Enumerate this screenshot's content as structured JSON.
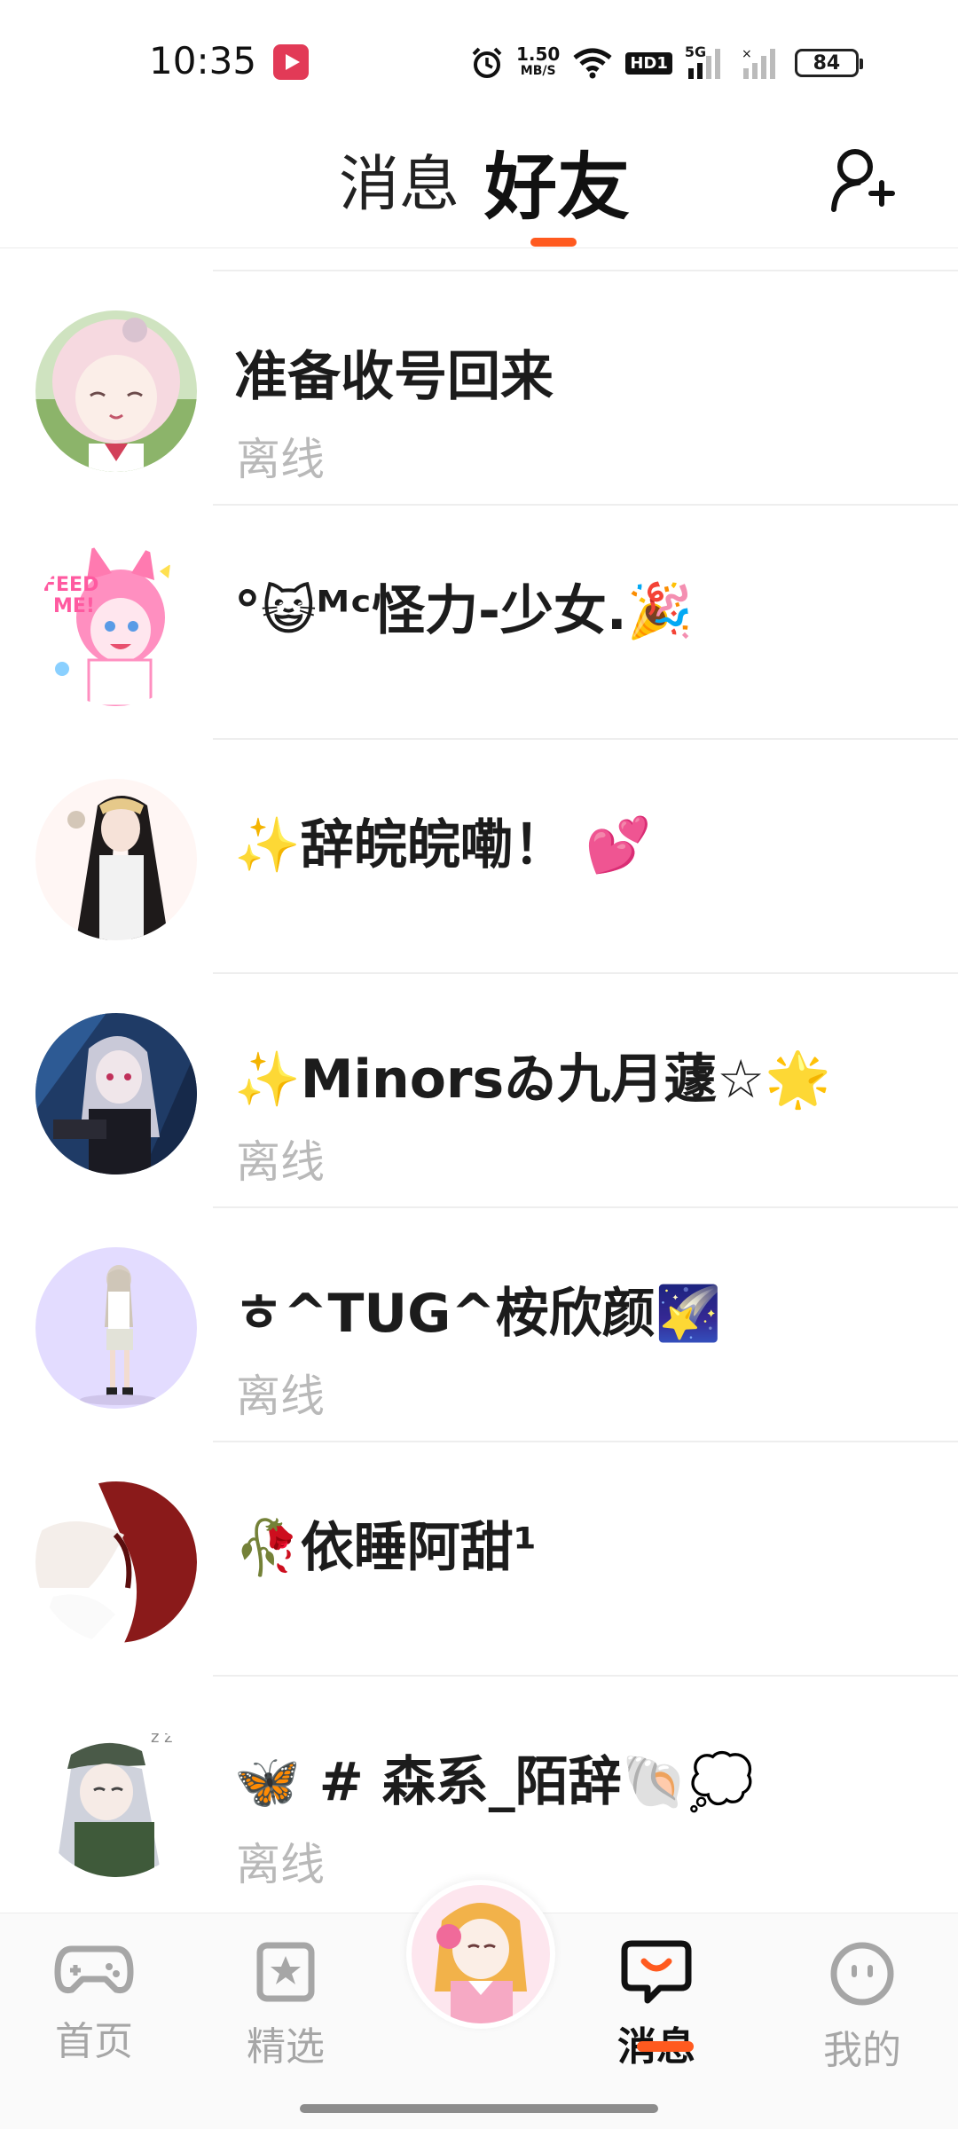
{
  "status_bar": {
    "time": "10:35",
    "net_speed_value": "1.50",
    "net_speed_unit": "MB/S",
    "hd_label": "HD1",
    "gen_label": "5G",
    "battery": "84"
  },
  "header": {
    "tab_messages": "消息",
    "tab_friends": "好友",
    "active_tab": "好友",
    "accent_color": "#ff5a1f"
  },
  "friends": [
    {
      "name": "准备收号回来",
      "status": "离线"
    },
    {
      "name": "°😺ᴹᶜ怪力-少女.🎉",
      "status": ""
    },
    {
      "name": "✨辞皖皖嘞！ 💕",
      "status": ""
    },
    {
      "name": "✨Minorsゐ九月蘧☆🌟",
      "status": "离线"
    },
    {
      "name": "ㅎ^TUG^桉欣颜🌠",
      "status": "离线"
    },
    {
      "name": "🥀依睡阿甜¹",
      "status": ""
    },
    {
      "name": "🦋 # 森系_陌辞🐚💭",
      "status": "离线"
    }
  ],
  "bottom_nav": {
    "home": "首页",
    "featured": "精选",
    "messages": "消息",
    "me": "我的",
    "active": "消息"
  }
}
